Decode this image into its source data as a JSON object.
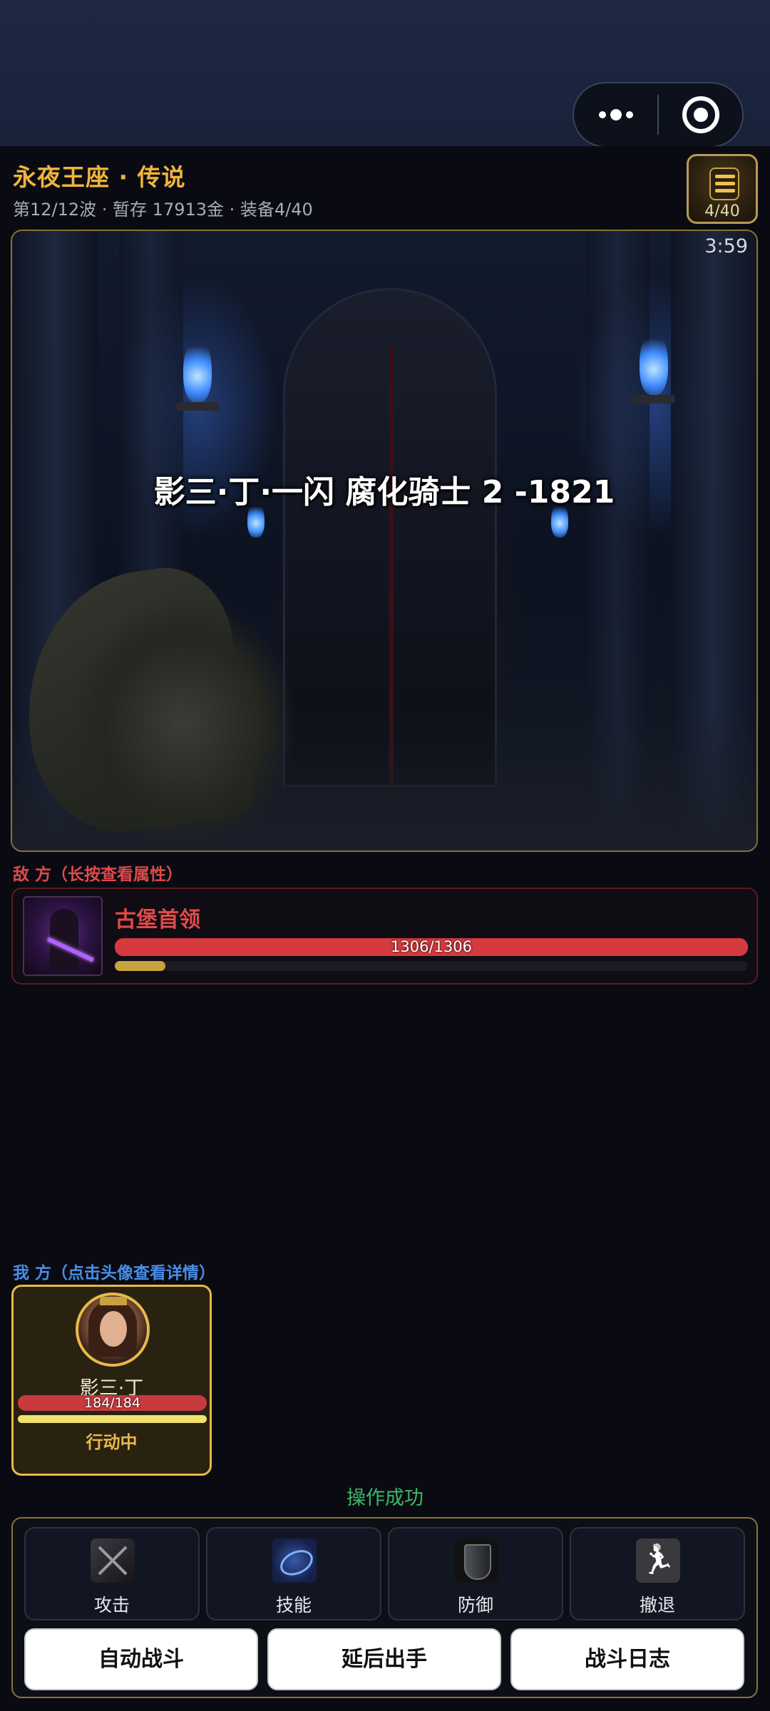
{
  "header": {
    "title": "永夜王座 · 传说",
    "subtitle": "第12/12波 · 暂存 17913金 · 装备4/40",
    "bag_count": "4/40"
  },
  "scene": {
    "timer": "3:59",
    "caption": "影三·丁·一闪 腐化骑士 2 -1821"
  },
  "enemy": {
    "section_label": "敌 方（长按查看属性）",
    "name": "古堡首领",
    "hp_text": "1306/1306",
    "hp_fraction": 1.0,
    "action_fraction": 0.08
  },
  "ally": {
    "section_label": "我 方（点击头像查看详情）",
    "name": "影三·丁",
    "hp_text": "184/184",
    "hp_fraction": 1.0,
    "action_fraction": 1.0,
    "status": "行动中"
  },
  "message": "操作成功",
  "actions": [
    {
      "label": "攻击",
      "icon": "sword-icon"
    },
    {
      "label": "技能",
      "icon": "skill-icon"
    },
    {
      "label": "防御",
      "icon": "shield-icon"
    },
    {
      "label": "撤退",
      "icon": "run-icon"
    }
  ],
  "buttons": {
    "auto": "自动战斗",
    "delay": "延后出手",
    "log": "战斗日志"
  },
  "colors": {
    "title_gold": "#f0b43c",
    "enemy_red": "#e04a4a",
    "ally_blue": "#4a8ee8",
    "success_green": "#3cb86a",
    "hp_red": "#c83a3e",
    "frame_gold": "#e8b84a"
  }
}
